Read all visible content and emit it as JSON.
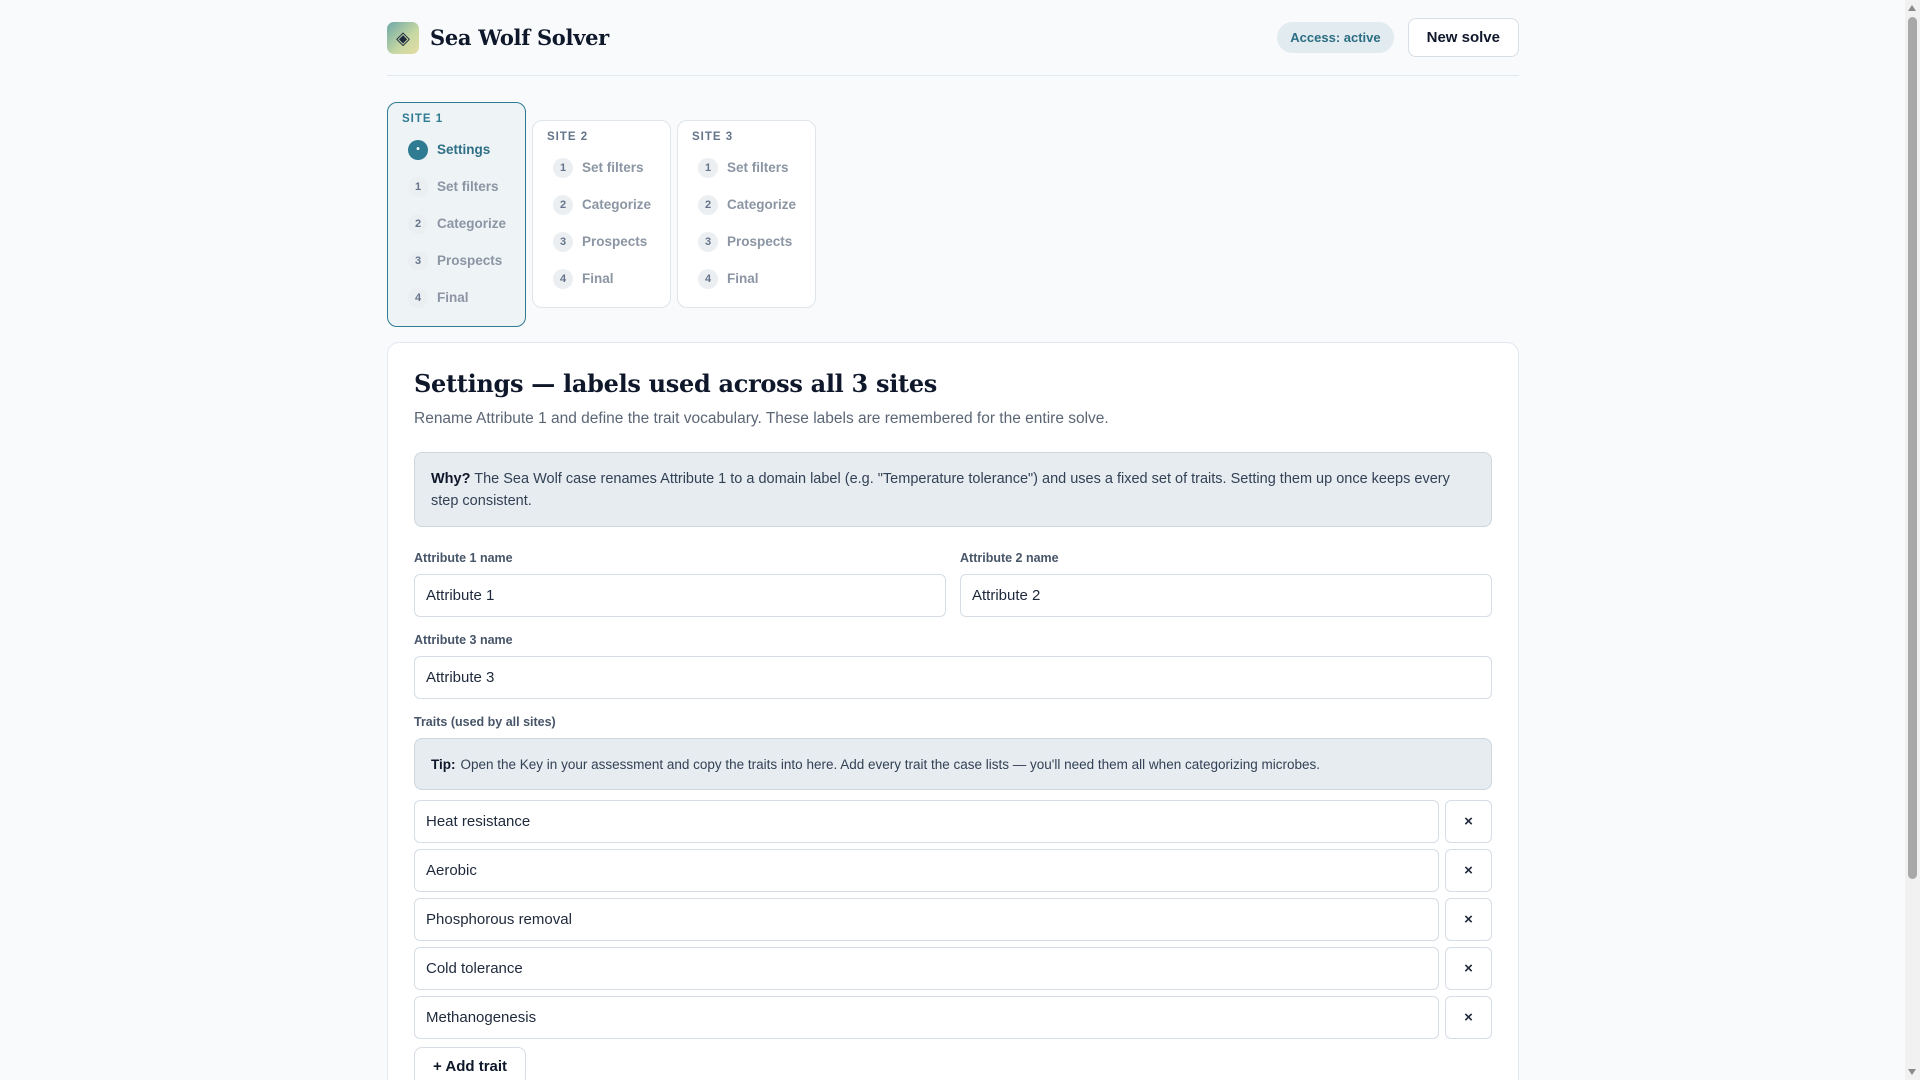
{
  "app": {
    "title": "Sea Wolf Solver",
    "logo_icon": "diamond-icon",
    "access_badge": "Access: active",
    "new_solve_label": "New solve"
  },
  "sites": [
    {
      "label": "SITE 1",
      "active": true,
      "steps": [
        {
          "num": "•",
          "label": "Settings",
          "current": true
        },
        {
          "num": "1",
          "label": "Set filters"
        },
        {
          "num": "2",
          "label": "Categorize"
        },
        {
          "num": "3",
          "label": "Prospects"
        },
        {
          "num": "4",
          "label": "Final"
        }
      ]
    },
    {
      "label": "SITE 2",
      "active": false,
      "steps": [
        {
          "num": "1",
          "label": "Set filters"
        },
        {
          "num": "2",
          "label": "Categorize"
        },
        {
          "num": "3",
          "label": "Prospects"
        },
        {
          "num": "4",
          "label": "Final"
        }
      ]
    },
    {
      "label": "SITE 3",
      "active": false,
      "steps": [
        {
          "num": "1",
          "label": "Set filters"
        },
        {
          "num": "2",
          "label": "Categorize"
        },
        {
          "num": "3",
          "label": "Prospects"
        },
        {
          "num": "4",
          "label": "Final"
        }
      ]
    }
  ],
  "settings": {
    "title": "Settings — labels used across all 3 sites",
    "subtitle": "Rename Attribute 1 and define the trait vocabulary. These labels are remembered for the entire solve.",
    "why_label": "Why?",
    "why_text": "The Sea Wolf case renames Attribute 1 to a domain label (e.g. \"Temperature tolerance\") and uses a fixed set of traits. Setting them up once keeps every step consistent.",
    "attr1_label": "Attribute 1 name",
    "attr1_value": "Attribute 1",
    "attr2_label": "Attribute 2 name",
    "attr2_value": "Attribute 2",
    "attr3_label": "Attribute 3 name",
    "attr3_value": "Attribute 3",
    "traits_label": "Traits (used by all sites)",
    "tip_label": "Tip:",
    "tip_text": "Open the Key in your assessment and copy the traits into here. Add every trait the case lists — you'll need them all when categorizing microbes.",
    "traits": [
      "Heat resistance",
      "Aerobic",
      "Phosphorous removal",
      "Cold tolerance",
      "Methanogenesis"
    ],
    "remove_symbol": "×",
    "add_trait_label": "+ Add trait"
  }
}
